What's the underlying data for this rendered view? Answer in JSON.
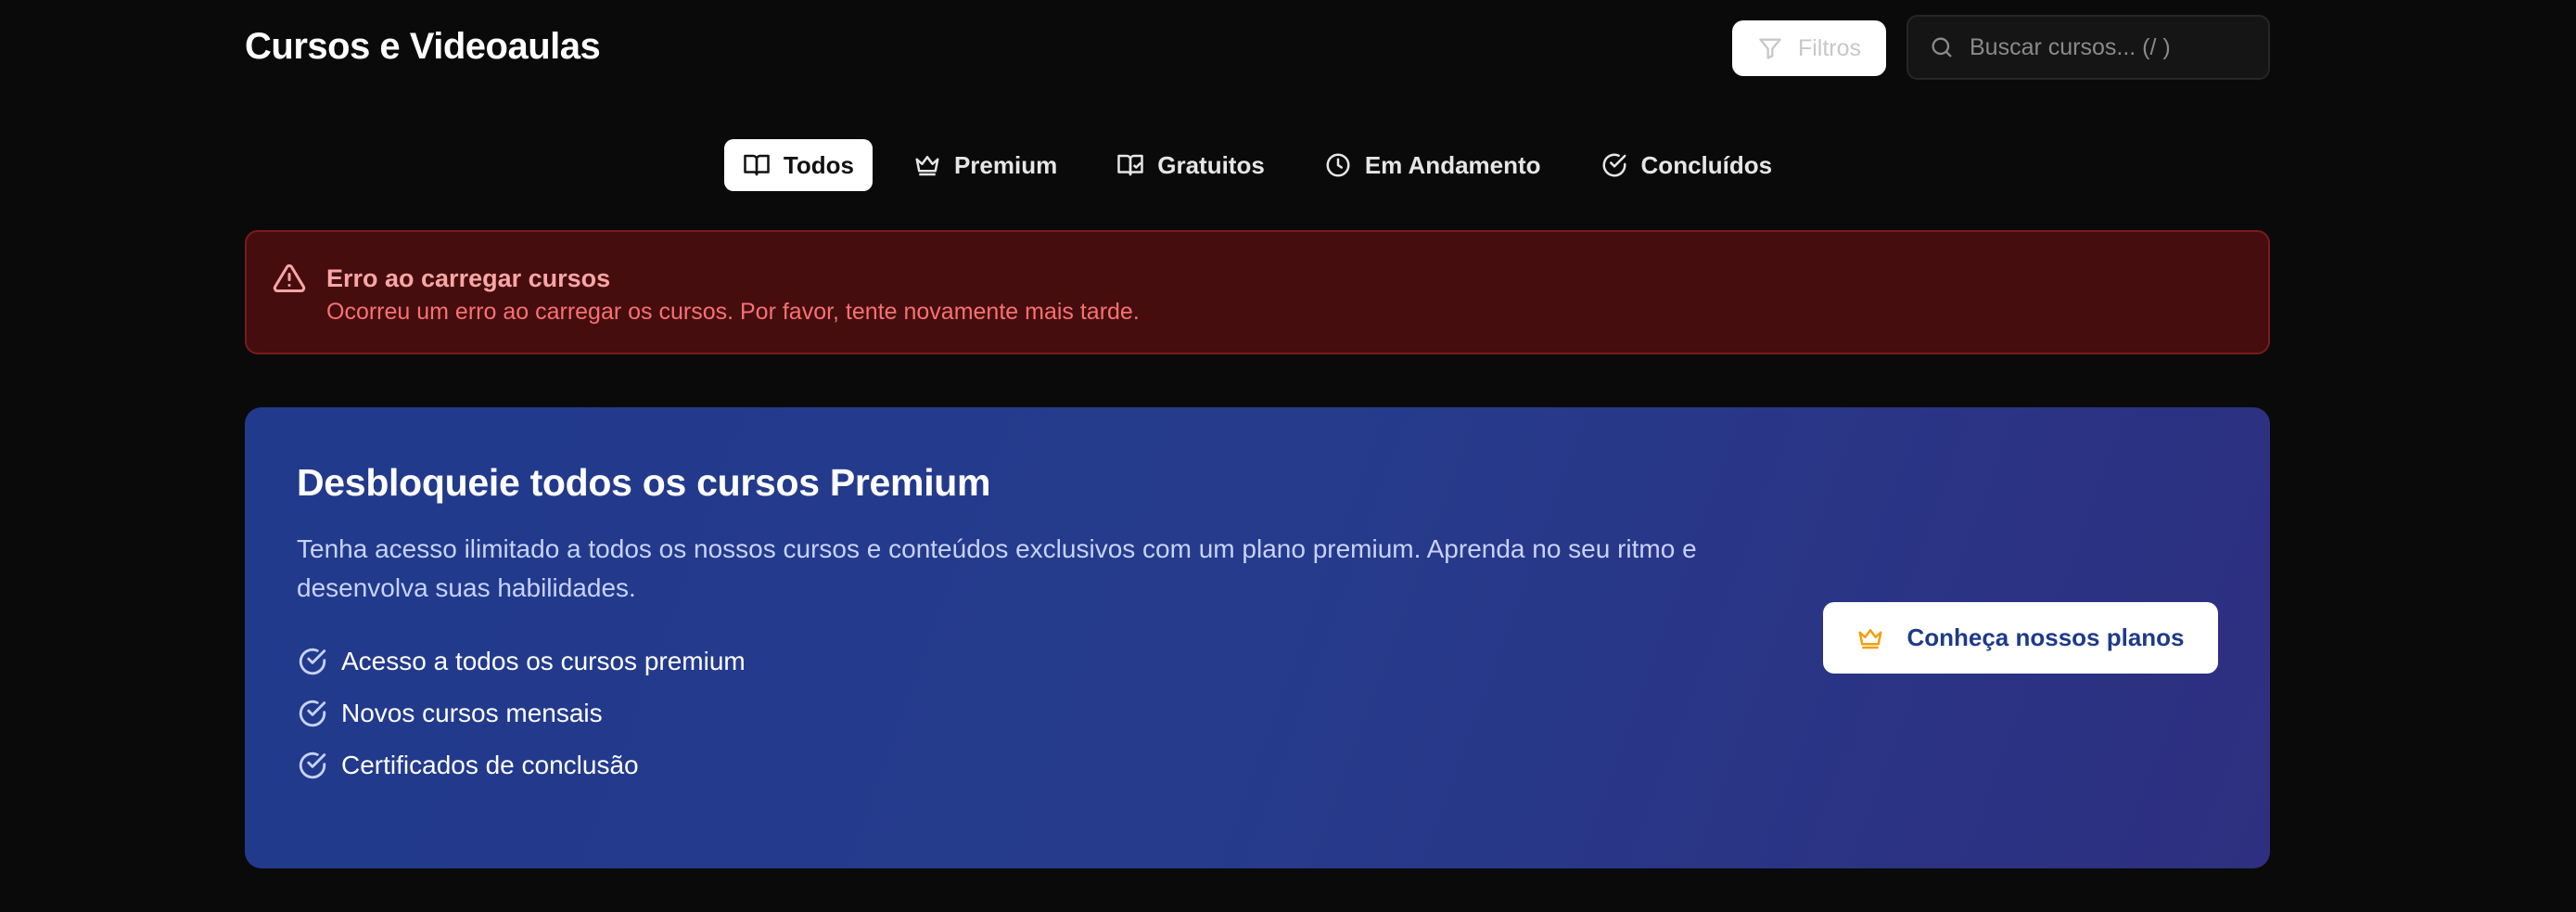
{
  "header": {
    "title": "Cursos e Videoaulas",
    "filters_label": "Filtros",
    "search_placeholder": "Buscar cursos... (/ )"
  },
  "tabs": [
    {
      "label": "Todos",
      "icon": "book-open-icon",
      "active": true
    },
    {
      "label": "Premium",
      "icon": "crown-icon",
      "active": false
    },
    {
      "label": "Gratuitos",
      "icon": "book-icon",
      "active": false
    },
    {
      "label": "Em Andamento",
      "icon": "clock-icon",
      "active": false
    },
    {
      "label": "Concluídos",
      "icon": "check-circle-icon",
      "active": false
    }
  ],
  "alert": {
    "title": "Erro ao carregar cursos",
    "message": "Ocorreu um erro ao carregar os cursos. Por favor, tente novamente mais tarde.",
    "icon": "warning-triangle-icon"
  },
  "promo": {
    "title": "Desbloqueie todos os cursos Premium",
    "description": "Tenha acesso ilimitado a todos os nossos cursos e conteúdos exclusivos com um plano premium. Aprenda no seu ritmo e desenvolva suas habilidades.",
    "features": [
      "Acesso a todos os cursos premium",
      "Novos cursos mensais",
      "Certificados de conclusão"
    ],
    "cta_label": "Conheça nossos planos"
  },
  "colors": {
    "background": "#0a0a0a",
    "alert_bg": "#450d0e",
    "alert_title": "#fca5a5",
    "alert_text": "#f87171",
    "promo_gradient_start": "#213a8b",
    "promo_gradient_end": "#2e2f80",
    "crown_accent": "#f59e0b",
    "cta_text": "#1e3a8a"
  }
}
